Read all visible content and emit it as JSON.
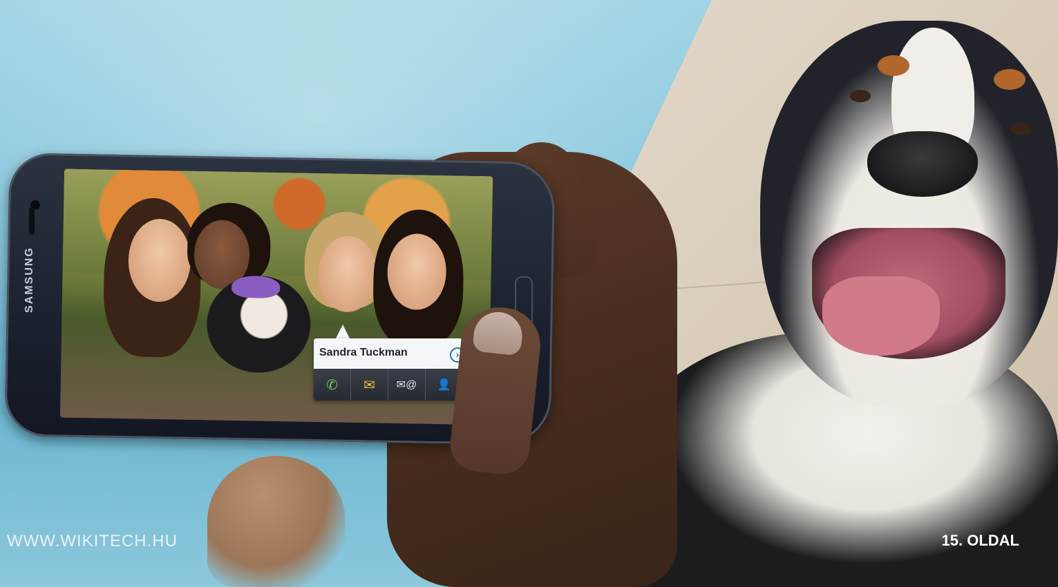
{
  "phone": {
    "brand": "SAMSUNG"
  },
  "contact_card": {
    "name": "Sandra Tuckman",
    "actions": [
      {
        "icon": "phone-icon",
        "glyph": "✆"
      },
      {
        "icon": "mail-icon",
        "glyph": "✉"
      },
      {
        "icon": "email-icon",
        "glyph": "✉@"
      },
      {
        "icon": "contact-icon",
        "glyph": "👤"
      }
    ]
  },
  "footer": {
    "website": "WWW.WIKITECH.HU",
    "page": "15. OLDAL"
  }
}
